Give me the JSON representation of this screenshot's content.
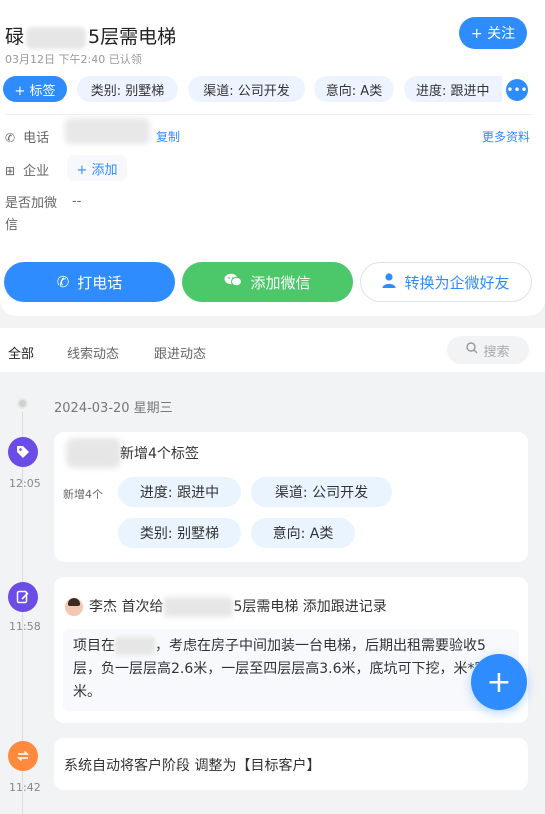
{
  "header": {
    "title_prefix": "碌",
    "title_suffix": "5层需电梯",
    "subtitle": "03月12日 下午2:40 已认领",
    "follow_label": "+ 关注"
  },
  "tags": {
    "add_label": "+ 标签",
    "items": [
      "类别: 别墅梯",
      "渠道: 公司开发",
      "意向: A类",
      "进度: 跟进中"
    ],
    "more_icon": "more-dots-icon"
  },
  "info": {
    "phone_label": "电话",
    "copy_label": "复制",
    "more_label": "更多资料",
    "company_label": "企业",
    "company_add_label": "+ 添加",
    "wechat_label": "是否加微信",
    "wechat_value": "--"
  },
  "actions": {
    "call_label": "打电话",
    "wechat_label": "添加微信",
    "convert_label": "转换为企微好友"
  },
  "tabs": {
    "items": [
      "全部",
      "线索动态",
      "跟进动态"
    ],
    "active": "全部",
    "search_placeholder": "搜索"
  },
  "timeline": {
    "date": "2024-03-20 星期三",
    "events": [
      {
        "time": "12:05",
        "icon": "tag-icon",
        "color": "#6b4ce6",
        "title": "新增4个标签",
        "new_label": "新增4个",
        "tags": [
          "进度: 跟进中",
          "渠道: 公司开发",
          "类别: 别墅梯",
          "意向: A类"
        ]
      },
      {
        "time": "11:58",
        "icon": "edit-note-icon",
        "color": "#6b4ce6",
        "user": "李杰",
        "title_prefix": "首次给",
        "title_suffix": "5层需电梯 添加跟进记录",
        "body_prefix": "项目在",
        "body_suffix": "，考虑在房子中间加装一台电梯，后期出租需要验收5层，负一层层高2.6米，一层至四层层高3.6米，底坑可下挖，米*宽4米。"
      },
      {
        "time": "11:42",
        "icon": "swap-icon",
        "color": "#ff8a3d",
        "title": "系统自动将客户阶段 调整为【目标客户】"
      }
    ]
  },
  "fab": {
    "label": "+"
  },
  "colors": {
    "primary": "#2f8cff",
    "success": "#4cc76a",
    "purple": "#6b4ce6",
    "orange": "#ff8a3d"
  }
}
